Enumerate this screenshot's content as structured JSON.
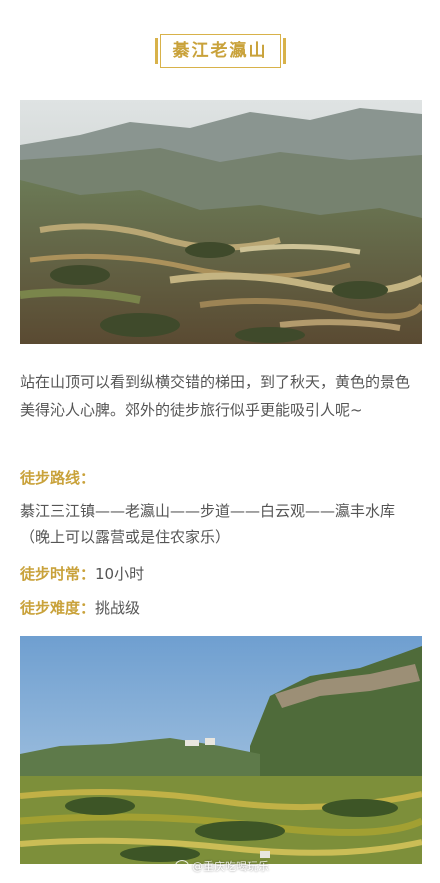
{
  "header": {
    "title": "綦江老瀛山"
  },
  "article": {
    "intro": "站在山顶可以看到纵横交错的梯田，到了秋天，黄色的景色美得沁人心脾。郊外的徒步旅行似乎更能吸引人呢~",
    "route_label": "徒步路线：",
    "route_text": "綦江三江镇——老瀛山——步道——白云观——瀛丰水库（晚上可以露营或是住农家乐）",
    "duration_label": "徒步时常：",
    "duration_value": "10小时",
    "difficulty_label": "徒步难度：",
    "difficulty_value": "挑战级"
  },
  "photos": [
    {
      "name": "terraced-fields-photo"
    },
    {
      "name": "mountain-cliff-photo"
    }
  ],
  "watermark": {
    "icon": "weibo-icon",
    "text": "@重庆吃喝玩乐"
  },
  "colors": {
    "accent": "#c9a23b",
    "border": "#d8b24a",
    "body_text": "#555555"
  }
}
